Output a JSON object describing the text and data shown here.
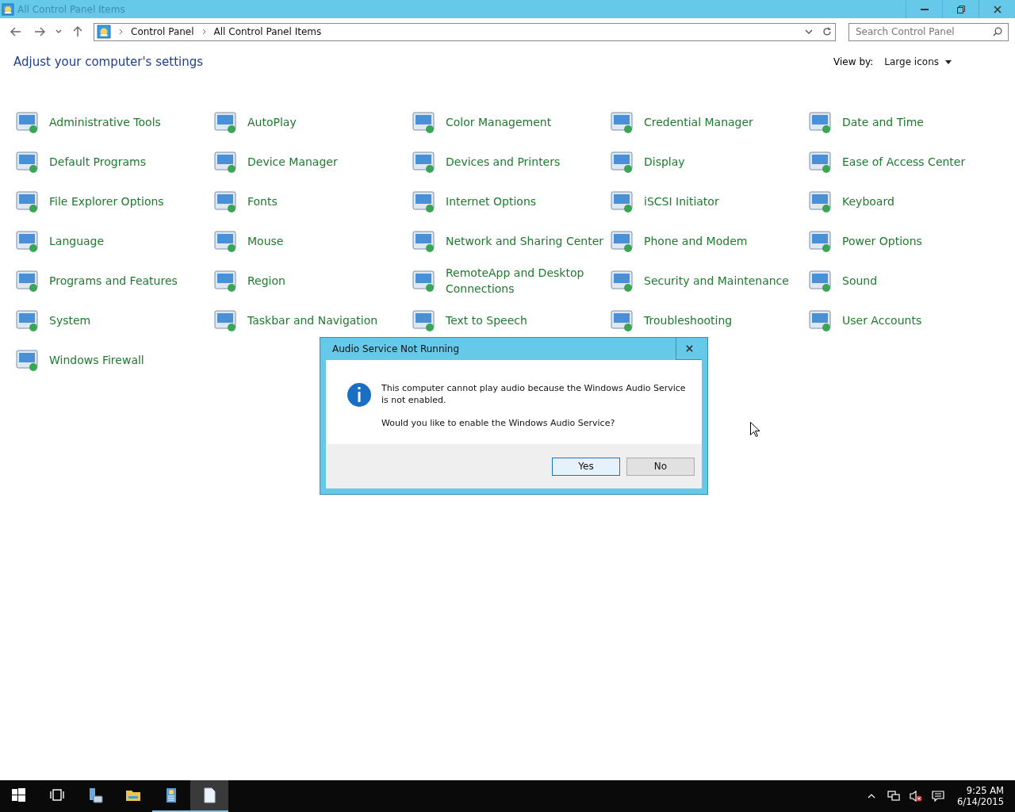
{
  "window": {
    "title": "All Control Panel Items"
  },
  "address": {
    "crumbs": [
      "Control Panel",
      "All Control Panel Items"
    ]
  },
  "search": {
    "placeholder": "Search Control Panel"
  },
  "heading": "Adjust your computer's settings",
  "view_by": {
    "label": "View by:",
    "value": "Large icons"
  },
  "items": [
    {
      "label": "Administrative Tools"
    },
    {
      "label": "AutoPlay"
    },
    {
      "label": "Color Management"
    },
    {
      "label": "Credential Manager"
    },
    {
      "label": "Date and Time"
    },
    {
      "label": "Default Programs"
    },
    {
      "label": "Device Manager"
    },
    {
      "label": "Devices and Printers"
    },
    {
      "label": "Display"
    },
    {
      "label": "Ease of Access Center"
    },
    {
      "label": "File Explorer Options"
    },
    {
      "label": "Fonts"
    },
    {
      "label": "Internet Options"
    },
    {
      "label": "iSCSI Initiator"
    },
    {
      "label": "Keyboard"
    },
    {
      "label": "Language"
    },
    {
      "label": "Mouse"
    },
    {
      "label": "Network and Sharing Center"
    },
    {
      "label": "Phone and Modem"
    },
    {
      "label": "Power Options"
    },
    {
      "label": "Programs and Features"
    },
    {
      "label": "Region"
    },
    {
      "label": "RemoteApp and Desktop Connections"
    },
    {
      "label": "Security and Maintenance"
    },
    {
      "label": "Sound"
    },
    {
      "label": "System"
    },
    {
      "label": "Taskbar and Navigation"
    },
    {
      "label": "Text to Speech"
    },
    {
      "label": "Troubleshooting"
    },
    {
      "label": "User Accounts"
    },
    {
      "label": "Windows Firewall"
    }
  ],
  "dialog": {
    "title": "Audio Service Not Running",
    "message": "This computer cannot play audio because the Windows Audio Service is not enabled.",
    "question": "Would you like to enable the Windows Audio Service?",
    "buttons": [
      {
        "label": "Yes",
        "selected": true
      },
      {
        "label": "No",
        "selected": false
      }
    ]
  },
  "taskbar": {
    "apps": [
      {
        "kind": "start",
        "running": false,
        "selected": false
      },
      {
        "kind": "taskview",
        "running": false,
        "selected": false
      },
      {
        "kind": "server",
        "running": false,
        "selected": false
      },
      {
        "kind": "folder",
        "running": false,
        "selected": false
      },
      {
        "kind": "panel",
        "running": true,
        "selected": false
      },
      {
        "kind": "document",
        "running": true,
        "selected": true
      }
    ],
    "time": "9:25 AM",
    "date": "6/14/2015"
  }
}
